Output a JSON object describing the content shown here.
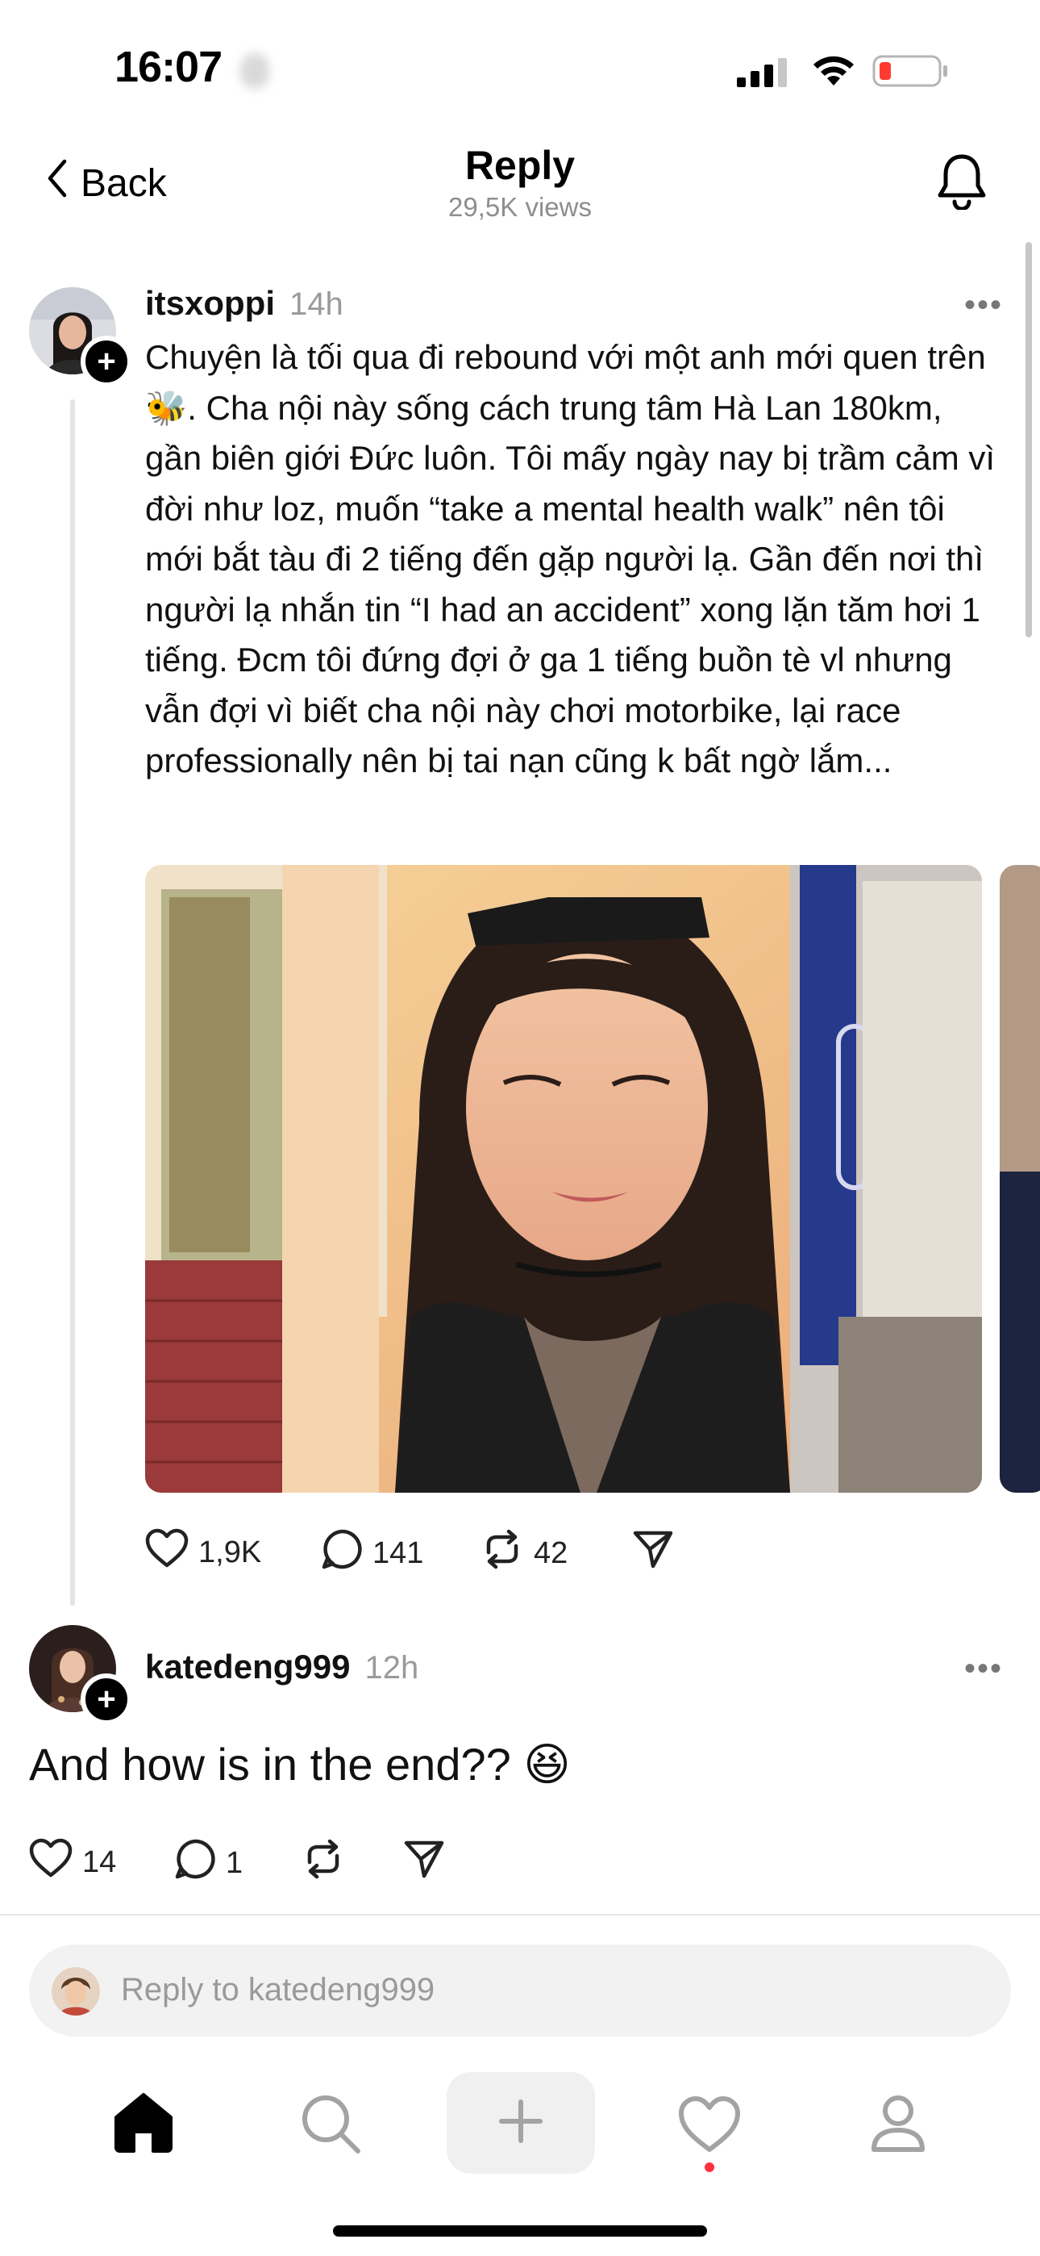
{
  "status_bar": {
    "time": "16:07"
  },
  "header": {
    "back_label": "Back",
    "title": "Reply",
    "views": "29,5K views"
  },
  "post": {
    "username": "itsxoppi",
    "time": "14h",
    "text": "Chuyện là tối qua đi rebound với một anh mới quen trên 🐝. Cha nội này sống cách trung tâm Hà Lan 180km, gần biên giới Đức luôn. Tôi mấy ngày nay bị trầm cảm vì đời như loz, muốn “take a mental health walk” nên tôi mới bắt tàu đi 2 tiếng đến gặp người lạ. Gần đến nơi thì người lạ nhắn tin “I had an accident” xong lặn tăm hơi 1 tiếng. Đcm tôi đứng đợi ở ga 1 tiếng buồn tè vl nhưng vẫn đợi vì biết cha nội này chơi motorbike, lại race professionally nên bị tai nạn cũng k bất ngờ lắm...",
    "likes": "1,9K",
    "comments": "141",
    "reposts": "42"
  },
  "reply": {
    "username": "katedeng999",
    "time": "12h",
    "text": "And how is in the end?? 😆",
    "likes": "14",
    "comments": "1"
  },
  "reply_input": {
    "placeholder": "Reply to katedeng999"
  },
  "nav": {
    "items": [
      "home-icon",
      "search-icon",
      "compose-icon",
      "activity-icon",
      "profile-icon"
    ],
    "notification_dot_color": "#ff3040"
  },
  "colors": {
    "battery_low": "#ff3b30",
    "secondary_text": "#8e8e8e"
  }
}
